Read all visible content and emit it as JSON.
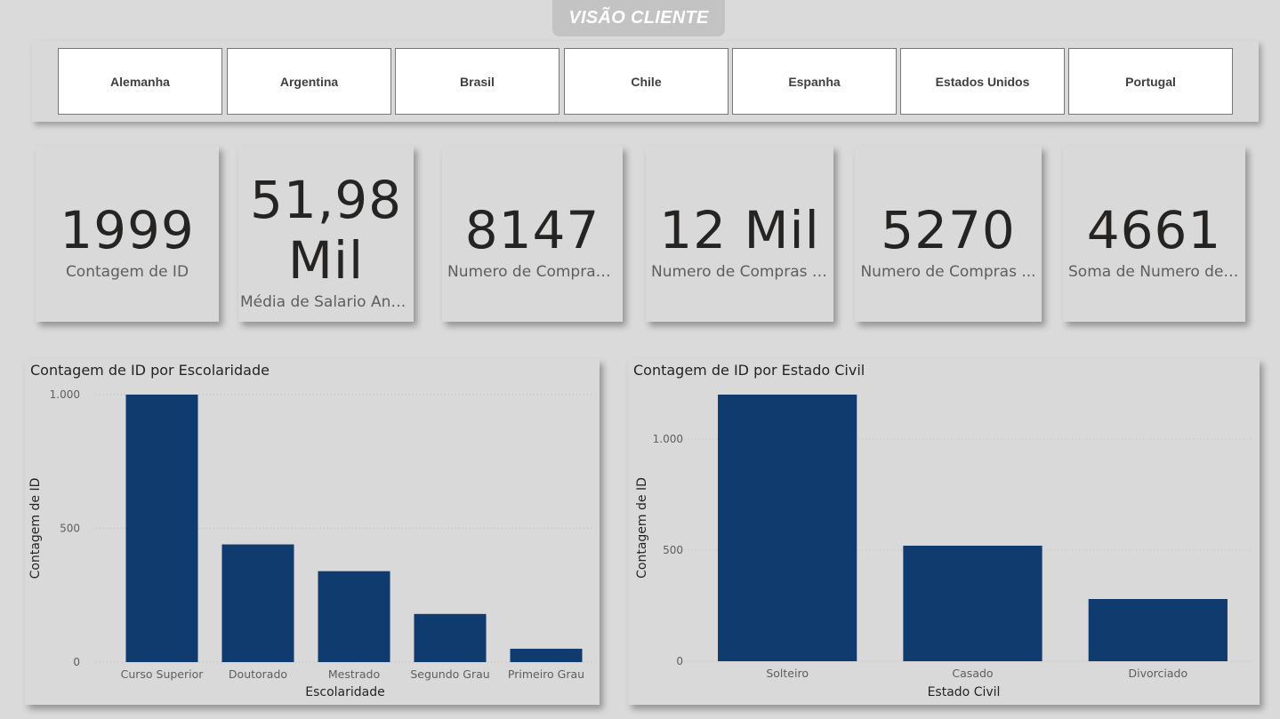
{
  "header": {
    "title": "VISÃO CLIENTE"
  },
  "slicer": {
    "items": [
      "Alemanha",
      "Argentina",
      "Brasil",
      "Chile",
      "Espanha",
      "Estados Unidos",
      "Portugal"
    ]
  },
  "cards": [
    {
      "value": "1999",
      "label": "Contagem de ID"
    },
    {
      "value_line1": "51,98",
      "value_line2": "Mil",
      "label": "Média de Salario Anual"
    },
    {
      "value": "8147",
      "label": "Numero de Compras ..."
    },
    {
      "value": "12 Mil",
      "label": "Numero de Compras n..."
    },
    {
      "value": "5270",
      "label": "Numero de Compras ..."
    },
    {
      "value": "4661",
      "label": "Soma de Numero de ..."
    }
  ],
  "colors": {
    "bar": "#0f3b6e",
    "background": "#dadada",
    "panel": "#d9d9d9"
  },
  "chart_data": [
    {
      "type": "bar",
      "title": "Contagem de ID por Escolaridade",
      "xlabel": "Escolaridade",
      "ylabel": "Contagem de ID",
      "categories": [
        "Curso Superior",
        "Doutorado",
        "Mestrado",
        "Segundo Grau",
        "Primeiro Grau"
      ],
      "values": [
        1000,
        440,
        340,
        180,
        50
      ],
      "ylim": [
        0,
        1000
      ],
      "yticks": [
        0,
        500,
        1000
      ],
      "ytick_labels": [
        "0",
        "500",
        "1.000"
      ],
      "grid": true
    },
    {
      "type": "bar",
      "title": "Contagem de ID por Estado Civil",
      "xlabel": "Estado Civil",
      "ylabel": "Contagem de ID",
      "categories": [
        "Solteiro",
        "Casado",
        "Divorciado"
      ],
      "values": [
        1200,
        520,
        280
      ],
      "ylim": [
        0,
        1200
      ],
      "yticks": [
        0,
        500,
        1000
      ],
      "ytick_labels": [
        "0",
        "500",
        "1.000"
      ],
      "grid": true
    }
  ]
}
